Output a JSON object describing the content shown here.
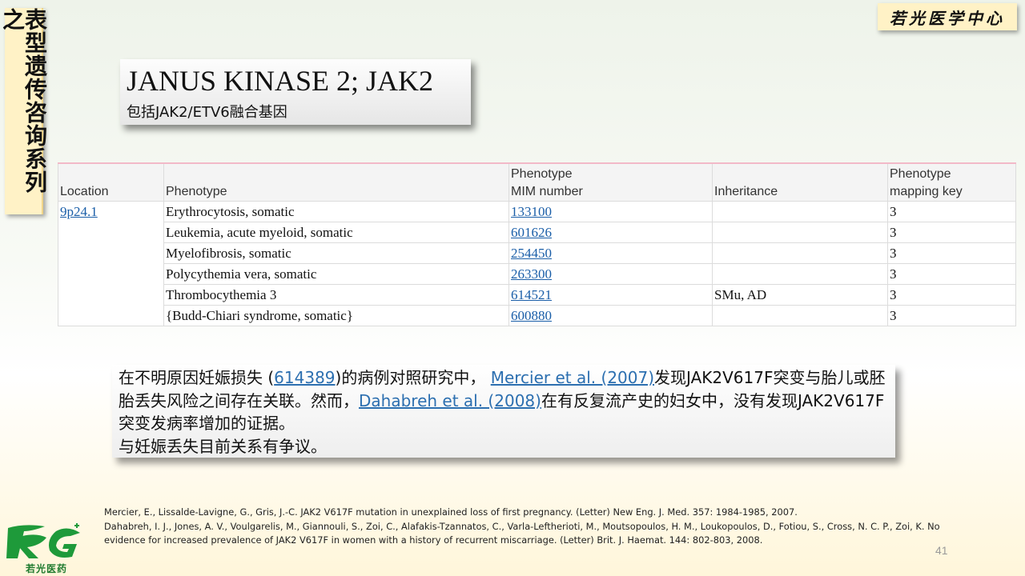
{
  "side_banner": {
    "text": "表型遗传咨询系列之"
  },
  "center_badge": {
    "text": "若光医学中心"
  },
  "title": {
    "main": "JANUS KINASE 2; JAK2",
    "sub": "包括JAK2/ETV6融合基因"
  },
  "table": {
    "headers": {
      "location": "Location",
      "phenotype": "Phenotype",
      "mim_line1": "Phenotype",
      "mim_line2": "MIM number",
      "inheritance": "Inheritance",
      "key_line1": "Phenotype",
      "key_line2": "mapping key"
    },
    "location": "9p24.1",
    "rows": [
      {
        "phenotype": "Erythrocytosis, somatic",
        "mim": "133100",
        "inheritance": "",
        "key": "3"
      },
      {
        "phenotype": "Leukemia, acute myeloid, somatic",
        "mim": "601626",
        "inheritance": "",
        "key": "3"
      },
      {
        "phenotype": "Myelofibrosis, somatic",
        "mim": "254450",
        "inheritance": "",
        "key": "3"
      },
      {
        "phenotype": "Polycythemia vera, somatic",
        "mim": "263300",
        "inheritance": "",
        "key": "3"
      },
      {
        "phenotype": "Thrombocythemia 3",
        "mim": "614521",
        "inheritance": "SMu, AD",
        "key": "3"
      },
      {
        "phenotype": "{Budd-Chiari syndrome, somatic}",
        "mim": "600880",
        "inheritance": "",
        "key": "3"
      }
    ]
  },
  "note": {
    "p1_a": "在不明原因妊娠损失 (",
    "p1_link1": "614389",
    "p1_b": ")的病例对照研究中，  ",
    "p1_link2": "Mercier et al. (2007)",
    "p1_c": "发现JAK2V617F突变与胎儿或胚胎丢失风险之间存在关联。然而，",
    "p1_link3": "Dahabreh et al. (2008)",
    "p1_d": "在有反复流产史的妇女中，没有发现JAK2V617F突变发病率增加的证据。",
    "p2": "与妊娠丢失目前关系有争议。"
  },
  "references": {
    "ref1": "Mercier, E., Lissalde-Lavigne, G., Gris, J.-C. JAK2 V617F mutation in unexplained loss of first pregnancy. (Letter) New Eng. J. Med. 357: 1984-1985, 2007.",
    "ref2": "Dahabreh, I. J., Jones, A. V., Voulgarelis, M., Giannouli, S., Zoi, C., Alafakis-Tzannatos, C., Varla-Leftherioti, M., Moutsopoulos, H. M., Loukopoulos, D., Fotiou, S., Cross, N. C. P., Zoi, K. No evidence for increased prevalence of JAK2 V617F in women with a history of recurrent miscarriage. (Letter) Brit. J. Haemat. 144: 802-803, 2008."
  },
  "page_number": "41",
  "logo": {
    "text": "若光医药",
    "icon": "rg-logo-icon",
    "color": "#1e9a3a"
  },
  "colors": {
    "link": "#1a5ea8",
    "badge_bg": "#fff2c6",
    "header_rule": "#f2b9c8"
  }
}
